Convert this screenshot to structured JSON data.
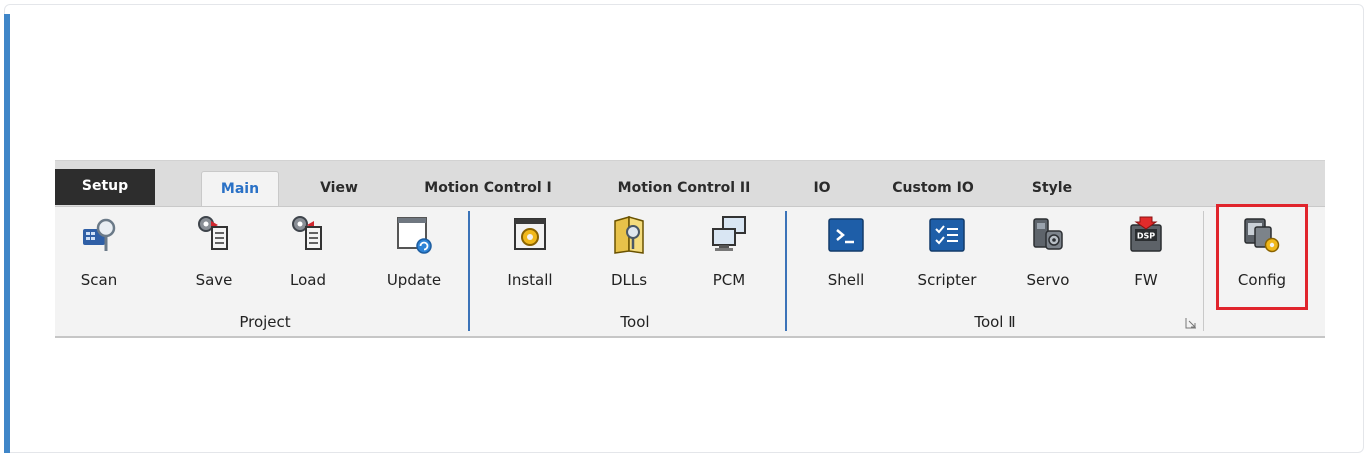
{
  "ribbon": {
    "tabs": [
      {
        "label": "Setup"
      },
      {
        "label": "Main"
      },
      {
        "label": "View"
      },
      {
        "label": "Motion Control I"
      },
      {
        "label": "Motion Control II"
      },
      {
        "label": "IO"
      },
      {
        "label": "Custom IO"
      },
      {
        "label": "Style"
      }
    ],
    "active_tab": "Main",
    "groups": {
      "project": {
        "label": "Project",
        "buttons": [
          {
            "label": "Scan",
            "icon": "scan-icon"
          },
          {
            "label": "Save",
            "icon": "save-icon"
          },
          {
            "label": "Load",
            "icon": "load-icon"
          },
          {
            "label": "Update",
            "icon": "update-icon"
          }
        ]
      },
      "tool": {
        "label": "Tool",
        "buttons": [
          {
            "label": "Install",
            "icon": "install-icon"
          },
          {
            "label": "DLLs",
            "icon": "dlls-icon"
          },
          {
            "label": "PCM",
            "icon": "pcm-icon"
          }
        ]
      },
      "tool2": {
        "label": "Tool Ⅱ",
        "buttons": [
          {
            "label": "Shell",
            "icon": "shell-icon"
          },
          {
            "label": "Scripter",
            "icon": "scripter-icon"
          },
          {
            "label": "Servo",
            "icon": "servo-icon"
          },
          {
            "label": "FW",
            "icon": "firmware-icon",
            "badge": "DSP"
          }
        ]
      },
      "config": {
        "buttons": [
          {
            "label": "Config",
            "icon": "config-icon",
            "highlighted": true
          }
        ]
      }
    },
    "colors": {
      "active_tab_text": "#2a71c6",
      "setup_tab_bg": "#2d2d2d",
      "separator": "#3b73b8",
      "highlight": "#e0242c",
      "accent_bar": "#3f86c8"
    }
  }
}
